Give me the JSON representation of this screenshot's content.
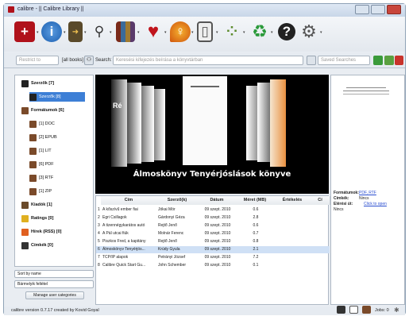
{
  "window": {
    "title": "calibre - || Calibre Library ||"
  },
  "toolbar": {
    "icons": [
      "add-books-icon",
      "info-icon",
      "convert-icon",
      "search-icon",
      "library-icon",
      "heart-icon",
      "location-icon",
      "device-icon",
      "news-icon",
      "recycle-icon",
      "help-icon",
      "preferences-icon"
    ]
  },
  "searchbar": {
    "restrict_placeholder": "Restrict to",
    "all_books": "[all books]",
    "search_label": "Search:",
    "search_placeholder": "Keresési kifejezés beírása a könyvtárban",
    "saved_placeholder": "Saved Searches"
  },
  "tags": {
    "items": [
      {
        "label": "Szerzők [7]",
        "level": 0,
        "icon": "author"
      },
      {
        "label": "Szerzők [8]",
        "level": 1,
        "icon": "author",
        "selected": true
      },
      {
        "label": "Formátumok [6]",
        "level": 0,
        "icon": "format"
      },
      {
        "label": "[1] DOC",
        "level": 1,
        "icon": "format"
      },
      {
        "label": "[2] EPUB",
        "level": 1,
        "icon": "format"
      },
      {
        "label": "[1] LIT",
        "level": 1,
        "icon": "format"
      },
      {
        "label": "[6] PDF",
        "level": 1,
        "icon": "format"
      },
      {
        "label": "[3] RTF",
        "level": 1,
        "icon": "format"
      },
      {
        "label": "[1] ZIP",
        "level": 1,
        "icon": "format"
      },
      {
        "label": "Kiadók [1]",
        "level": 0,
        "icon": "publisher"
      },
      {
        "label": "Ratings [0]",
        "level": 0,
        "icon": "rating"
      },
      {
        "label": "Hírek (RSS) [0]",
        "level": 0,
        "icon": "news"
      },
      {
        "label": "Címkék [0]",
        "level": 0,
        "icon": "tag"
      }
    ],
    "sort_label": "Sort by name",
    "match_label": "Bármelyik feltétel",
    "manage_label": "Manage user categories"
  },
  "cover": {
    "title": "Álmoskönyv Tenyérjóslások könyve",
    "side_text": "Ré"
  },
  "table": {
    "headers": [
      "Cím",
      "Szerző(k)",
      "Dátum",
      "Méret (MB)",
      "Értékelés",
      "Cí"
    ],
    "rows": [
      [
        "1",
        "A kőszívű ember fiai",
        "Jókai Mór",
        "09 szept. 2010",
        "0.6"
      ],
      [
        "2",
        "Egri Csillagok",
        "Gárdonyi Géza",
        "09 szept. 2010",
        "2.8"
      ],
      [
        "3",
        "A tizennégykarátos autó",
        "Rejtő Jenő",
        "09 szept. 2010",
        "0.6"
      ],
      [
        "4",
        "A Pál utcai fiúk",
        "Molnár Ferenc",
        "09 szept. 2010",
        "0.7"
      ],
      [
        "5",
        "Piszkos Fred, a kapitány",
        "Rejtő Jenő",
        "09 szept. 2010",
        "0.8"
      ],
      [
        "6",
        "Álmoskönyv Tenyérjós...",
        "Krúdy Gyula",
        "09 szept. 2010",
        "2.1"
      ],
      [
        "7",
        "TCP/IP alapok",
        "Petrányi József",
        "09 szept. 2010",
        "7.2"
      ],
      [
        "8",
        "Calibre Quick Start Gu...",
        "John Schember",
        "09 szept. 2010",
        "0.1"
      ]
    ],
    "selected_row": 5
  },
  "details": {
    "formats_label": "Formátumok:",
    "formats_value": "PDF, RTF",
    "tags_label": "Címkék:",
    "tags_value": "Nincs",
    "path_label": "Elérési út:",
    "path_value": "Click to open",
    "extra": "Nincs"
  },
  "status": {
    "version": "calibre version 0.7.17 created by Kovid Goyal",
    "jobs": "Jobs: 0"
  }
}
